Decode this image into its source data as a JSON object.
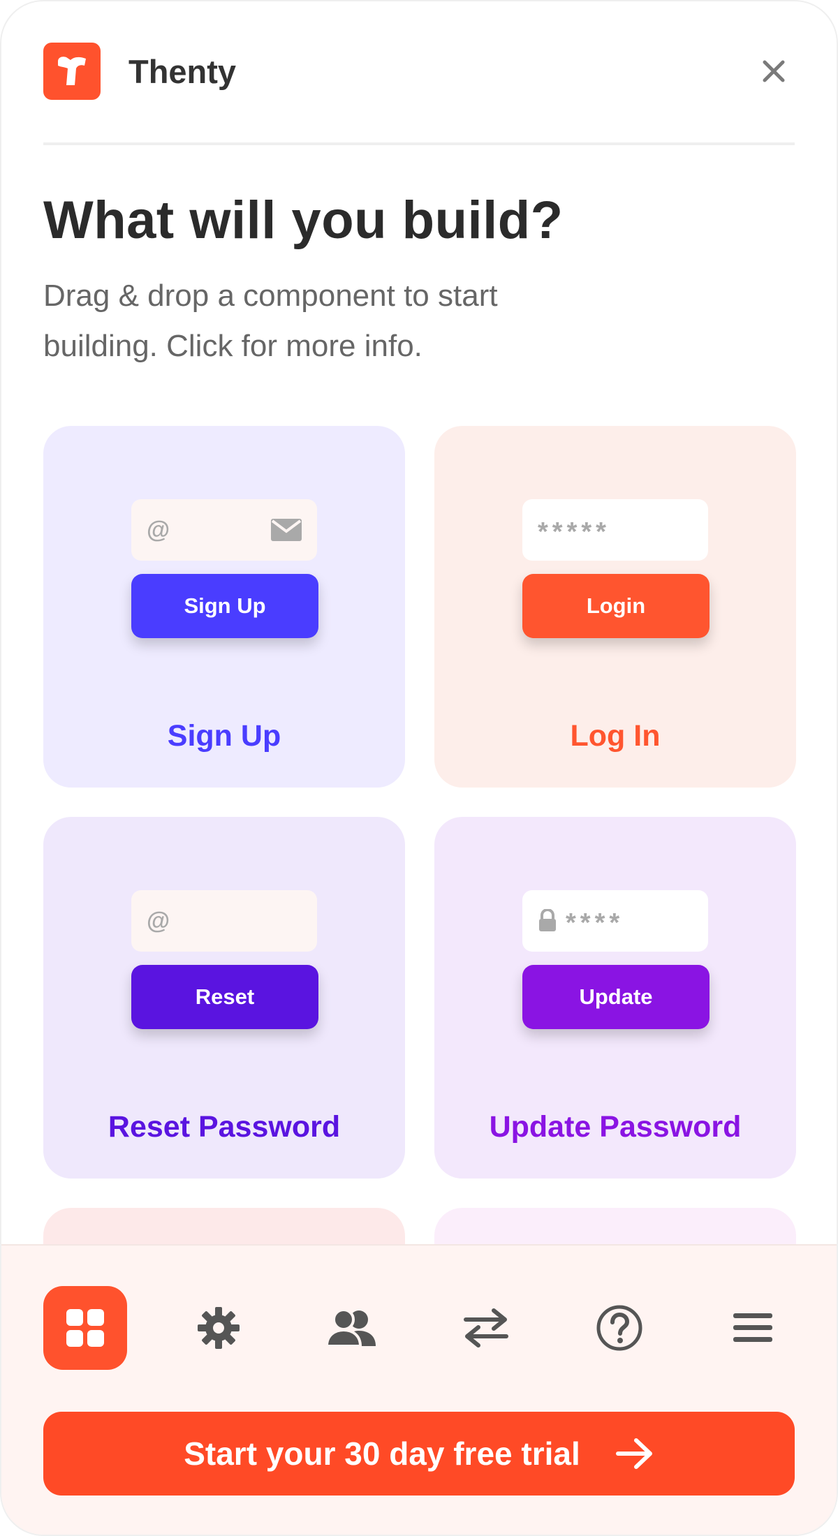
{
  "header": {
    "logo_icon": "thenty-logo-icon",
    "title": "Thenty",
    "close_icon": "close-icon"
  },
  "intro": {
    "heading": "What will you build?",
    "subtitle": "Drag & drop a component to start building. Click for more info."
  },
  "cards": [
    {
      "label": "Sign Up",
      "input_prefix": "@",
      "input_icon": "envelope-icon",
      "button_label": "Sign Up",
      "bg": "#eeebff",
      "accent": "#4a3dff"
    },
    {
      "label": "Log In",
      "input_prefix": "*****",
      "button_label": "Login",
      "bg": "#fdeeea",
      "accent": "#ff552f"
    },
    {
      "label": "Reset Password",
      "input_prefix": "@",
      "button_label": "Reset",
      "bg": "#efe8fc",
      "accent": "#5a14e0"
    },
    {
      "label": "Update Password",
      "input_prefix": "****",
      "input_icon": "lock-icon",
      "button_label": "Update",
      "bg": "#f3e8fc",
      "accent": "#8a14e3"
    }
  ],
  "nav": {
    "items": [
      {
        "icon": "grid-icon",
        "active": true
      },
      {
        "icon": "gear-icon"
      },
      {
        "icon": "users-icon"
      },
      {
        "icon": "swap-arrows-icon"
      },
      {
        "icon": "help-icon"
      },
      {
        "icon": "menu-icon"
      }
    ],
    "active_color": "#ff522d"
  },
  "cta": {
    "label": "Start your 30 day free trial",
    "icon": "arrow-right-icon",
    "color": "#ff4a26"
  }
}
